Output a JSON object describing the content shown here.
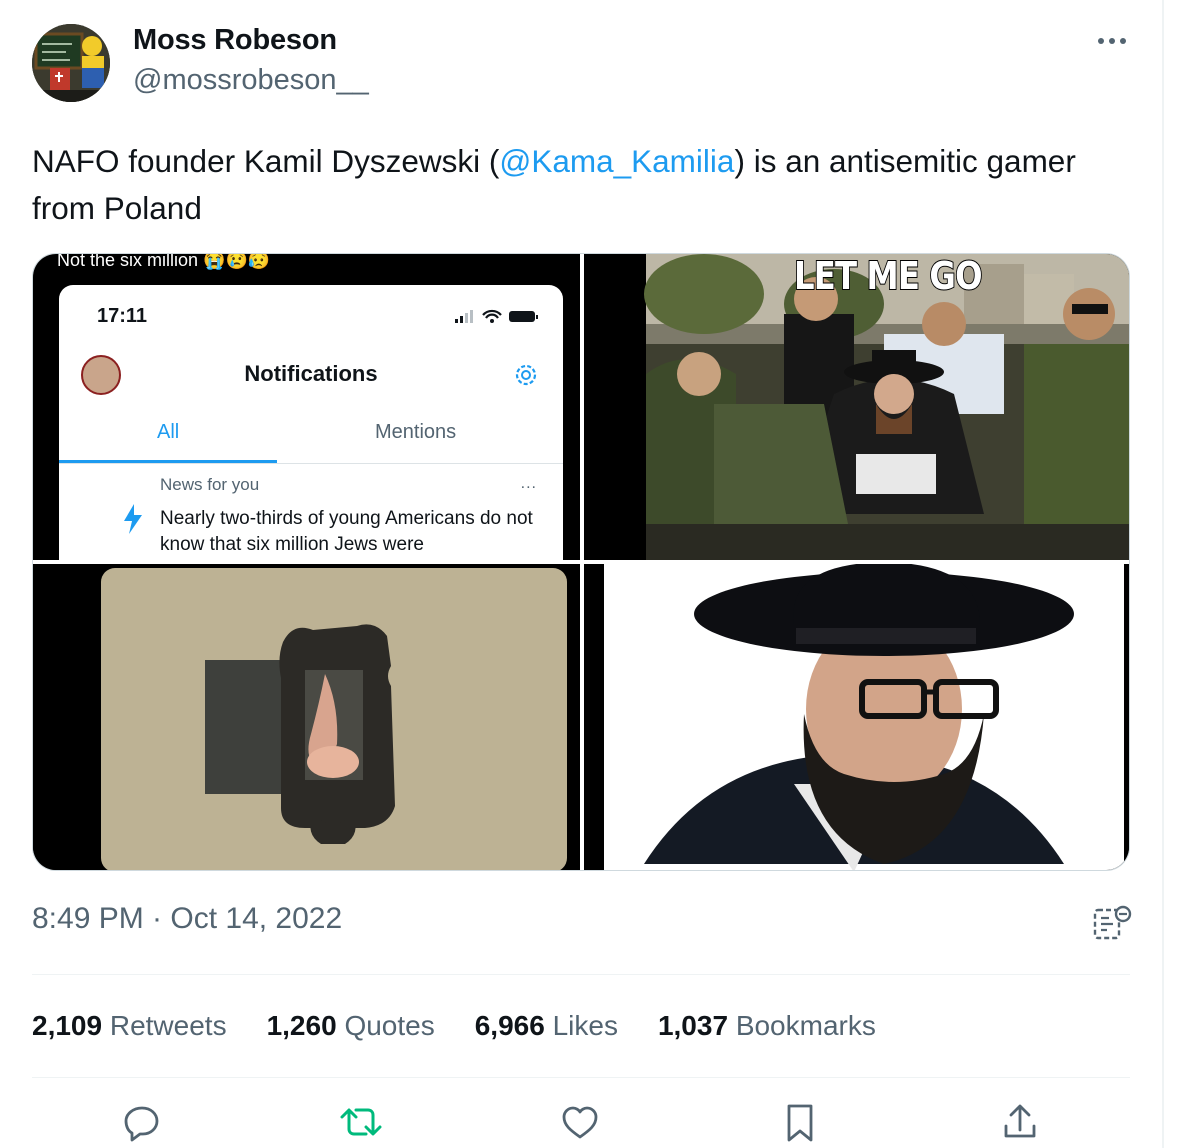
{
  "author": {
    "name": "Moss Robeson",
    "handle": "@mossrobeson__"
  },
  "tweet": {
    "text_before": "NAFO founder Kamil Dyszewski (",
    "mention": "@Kama_Kamilia",
    "text_after": ") is an antisemitic gamer from Poland"
  },
  "media": {
    "image1": {
      "caption": "Not the six million 😭😢😥",
      "phone_time": "17:11",
      "notifications_title": "Notifications",
      "tab_all": "All",
      "tab_mentions": "Mentions",
      "news_label": "News for you",
      "more": "...",
      "headline": "Nearly two-thirds of young Americans do not know that six million Jews were"
    },
    "image2": {
      "caption": "LET ME GO"
    }
  },
  "timestamp": "8:49 PM · Oct 14, 2022",
  "stats": {
    "retweets_count": "2,109",
    "retweets_label": "Retweets",
    "quotes_count": "1,260",
    "quotes_label": "Quotes",
    "likes_count": "6,966",
    "likes_label": "Likes",
    "bookmarks_count": "1,037",
    "bookmarks_label": "Bookmarks"
  },
  "actions": [
    "reply-icon",
    "retweet-icon",
    "like-icon",
    "bookmark-icon",
    "share-icon"
  ],
  "colors": {
    "accent": "#1d9bf0",
    "retweet": "#00ba7c",
    "text_secondary": "#536471"
  }
}
